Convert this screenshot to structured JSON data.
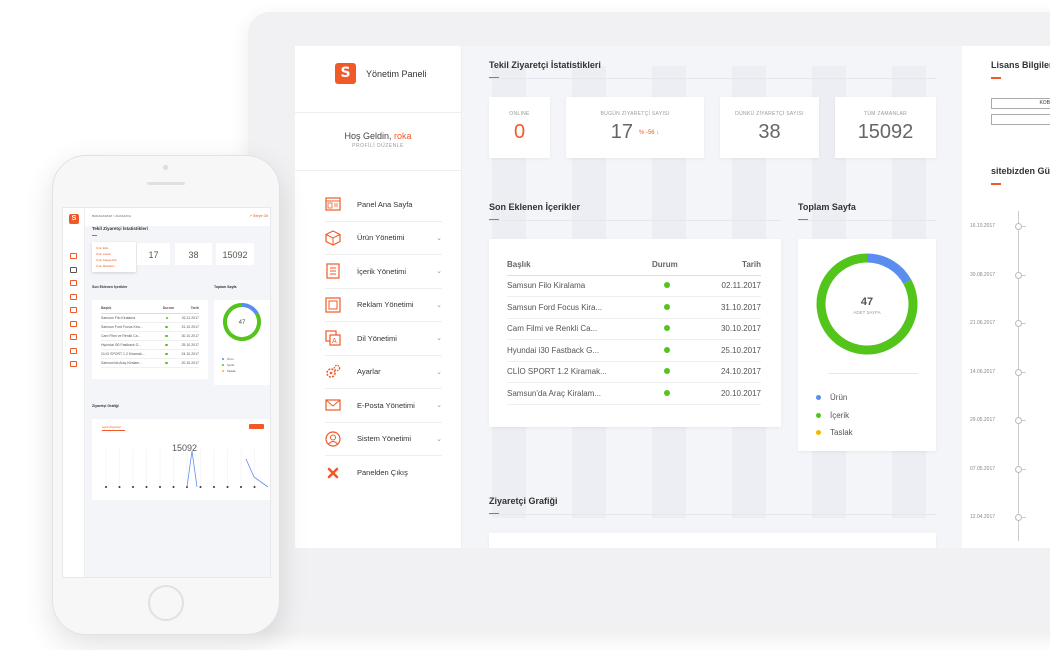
{
  "app": {
    "logo_letter": "S",
    "title": "Yönetim Paneli"
  },
  "welcome": {
    "prefix": "Hoş Geldin, ",
    "username": "roka",
    "profile_edit": "PROFİLİ DÜZENLE"
  },
  "nav": [
    {
      "label": "Panel Ana Sayfa",
      "icon": "dashboard-icon",
      "expandable": false
    },
    {
      "label": "Ürün Yönetimi",
      "icon": "box-icon",
      "expandable": true
    },
    {
      "label": "İçerik Yönetimi",
      "icon": "document-icon",
      "expandable": true
    },
    {
      "label": "Reklam Yönetimi",
      "icon": "ad-icon",
      "expandable": true
    },
    {
      "label": "Dil Yönetimi",
      "icon": "language-icon",
      "expandable": true
    },
    {
      "label": "Ayarlar",
      "icon": "gears-icon",
      "expandable": true
    },
    {
      "label": "E-Posta Yönetimi",
      "icon": "mail-icon",
      "expandable": true
    },
    {
      "label": "Sistem Yönetimi",
      "icon": "user-circle-icon",
      "expandable": true
    },
    {
      "label": "Panelden Çıkış",
      "icon": "close-icon",
      "expandable": false
    }
  ],
  "stats": {
    "title": "Tekil Ziyaretçi İstatistikleri",
    "online": {
      "label": "ONLINE",
      "value": "0"
    },
    "today": {
      "label": "BUGÜN ZİYARETÇİ SAYISI",
      "value": "17",
      "delta": "% -56 ↓"
    },
    "yesterday": {
      "label": "DÜNKÜ ZİYARETÇİ SAYISI",
      "value": "38"
    },
    "all_time": {
      "label": "TÜM ZAMANLAR",
      "value": "15092"
    }
  },
  "recent": {
    "title": "Son Eklenen İçerikler",
    "headers": [
      "Başlık",
      "Durum",
      "Tarih"
    ],
    "rows": [
      {
        "title": "Samsun Filo Kiralama",
        "date": "02.11.2017"
      },
      {
        "title": "Samsun Ford Focus Kira...",
        "date": "31.10.2017"
      },
      {
        "title": "Cam Filmi ve Renkli Ca...",
        "date": "30.10.2017"
      },
      {
        "title": "Hyundai i30 Fastback G...",
        "date": "25.10.2017"
      },
      {
        "title": "CLİO SPORT 1.2 Kiramak...",
        "date": "24.10.2017"
      },
      {
        "title": "Samsun'da Araç Kiralam...",
        "date": "20.10.2017"
      }
    ]
  },
  "pages": {
    "title": "Toplam Sayfa",
    "total": "47",
    "total_label": "ADET SAYFA",
    "legend": [
      {
        "label": "Ürün",
        "color": "#5b8def",
        "fraction": 0.17
      },
      {
        "label": "İçerik",
        "color": "#52c41a",
        "fraction": 0.83
      },
      {
        "label": "Taslak",
        "color": "#f5b800",
        "fraction": 0.0
      }
    ]
  },
  "visitor_chart": {
    "title": "Ziyaretçi Grafiği"
  },
  "license": {
    "title": "Lisans Bilgiler",
    "box1": "KOB",
    "box2": ""
  },
  "timeline": {
    "title": "sitebizden Gü",
    "dates": [
      "16.10.2017",
      "30.08.2017",
      "21.06.2017",
      "14.06.2017",
      "29.05.2017",
      "07.05.2017",
      "12.04.2017"
    ]
  },
  "phone": {
    "breadcrumb": "BURADASINIZ > ANASAYFA",
    "exit_link": "Siteye Git",
    "stats_title": "Tekil Ziyaretçi İstatistikleri",
    "dropdown": [
      "Ürün Ekle",
      "Ürün Listele",
      "Ürün Kategorileri",
      "Ürün Markaları"
    ],
    "stat_today": "17",
    "stat_yesterday": "38",
    "stat_total": "15092",
    "recent_title": "Son Eklenen İçerikler",
    "pages_title": "Toplam Sayfa",
    "pages_total": "47",
    "legend": [
      "Ürün",
      "İçerik",
      "Taslak"
    ],
    "chart_title": "Ziyaretçi Grafiği",
    "chart_tab": "Aylık Ziyaretçi",
    "chart_value": "15092",
    "headers": [
      "Başlık",
      "Durum",
      "Tarih"
    ],
    "rows": [
      {
        "title": "Samsun Filo Kiralama",
        "date": "02.11.2017"
      },
      {
        "title": "Samsun Ford Focus Kira...",
        "date": "31.10.2017"
      },
      {
        "title": "Cam Filmi ve Renkli Ca...",
        "date": "30.10.2017"
      },
      {
        "title": "Hyundai i30 Fastback G...",
        "date": "25.10.2017"
      },
      {
        "title": "CLİO SPORT 1.2 Kiramak...",
        "date": "24.10.2017"
      },
      {
        "title": "Samsun'da Araç Kiralam...",
        "date": "20.10.2017"
      }
    ]
  },
  "colors": {
    "accent": "#f05a28",
    "success": "#52c41a",
    "blue": "#5b8def"
  }
}
